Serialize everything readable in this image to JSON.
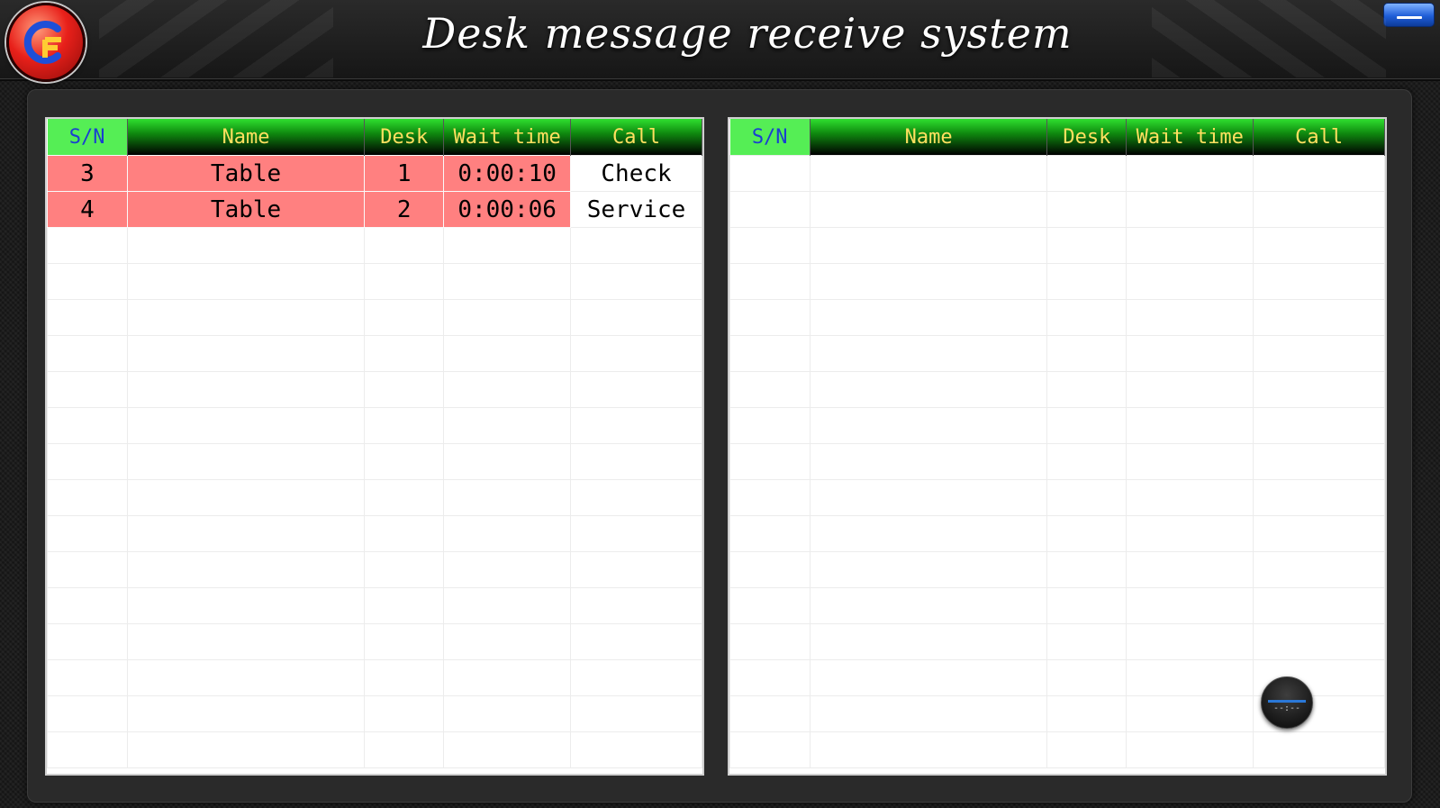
{
  "header": {
    "title": "Desk message receive system",
    "logo_letters": "CF"
  },
  "columns": [
    "S/N",
    "Name",
    "Desk",
    "Wait time",
    "Call"
  ],
  "left_table": {
    "rows": [
      {
        "sn": "3",
        "name": "Table",
        "desk": "1",
        "wait": "0:00:10",
        "call": "Check"
      },
      {
        "sn": "4",
        "name": "Table",
        "desk": "2",
        "wait": "0:00:06",
        "call": "Service"
      }
    ]
  },
  "right_table": {
    "rows": []
  },
  "clock": {
    "time": "--:--"
  },
  "colors": {
    "header_text": "#ffe060",
    "sn_header_bg": "#55ee55",
    "sn_header_text": "#1a3fd0",
    "active_row_bg": "#ff8080",
    "minimize_button": "#1f5ed8",
    "logo_red": "#e8201a"
  },
  "icons": {
    "logo": "cf-logo-icon",
    "minimize": "minimize-icon",
    "clock": "clock-icon"
  }
}
